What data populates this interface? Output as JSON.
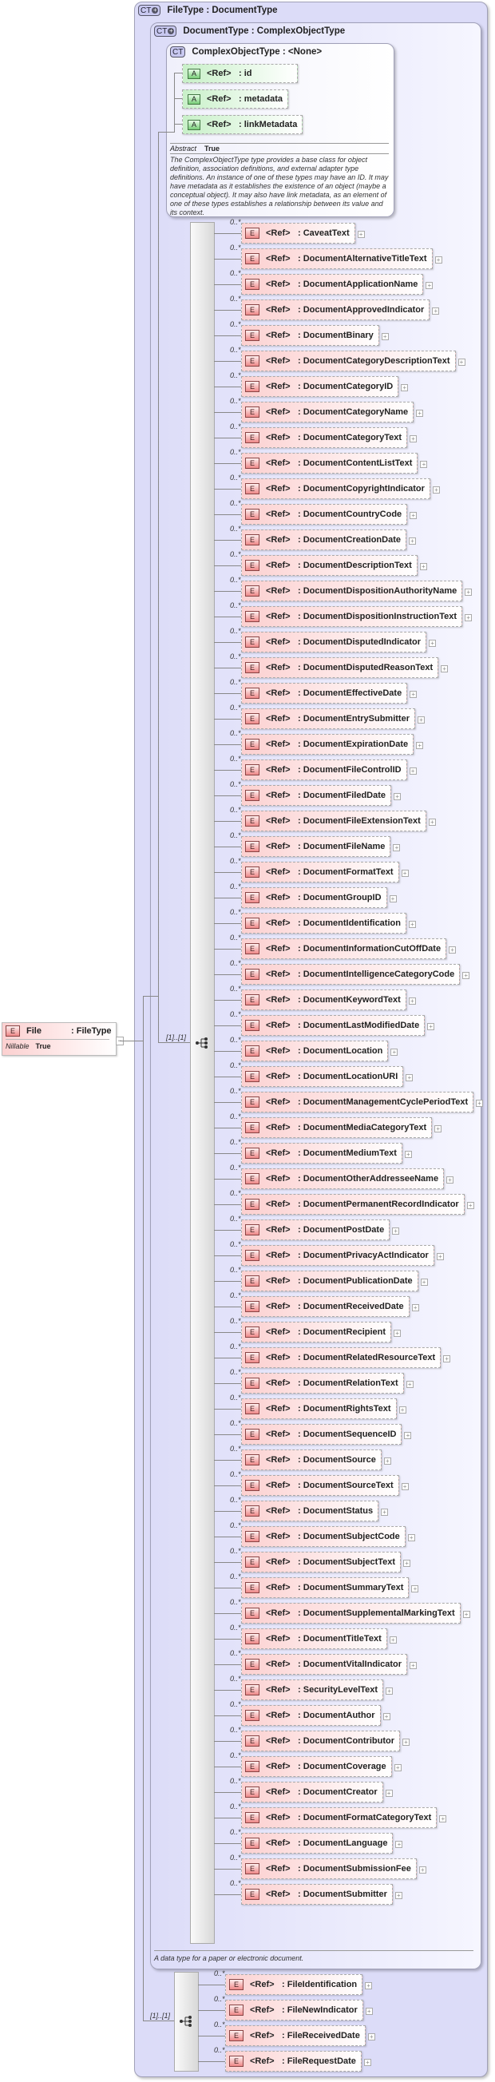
{
  "file": {
    "badge": "E",
    "name": "File",
    "type": ": FileType",
    "nillable_label": "Nillable",
    "nillable_value": "True",
    "collapse": "−"
  },
  "file_type": {
    "badge": "CT",
    "name": "FileType : DocumentType"
  },
  "document_type": {
    "badge": "CT",
    "name": "DocumentType : ComplexObjectType",
    "documentation": "A data type for a paper or electronic document."
  },
  "complex_object_type": {
    "badge": "CT",
    "name": "ComplexObjectType : <None>",
    "attributes": [
      {
        "badge": "A",
        "ref": "<Ref>",
        "name": ": id"
      },
      {
        "badge": "A",
        "ref": "<Ref>",
        "name": ": metadata"
      },
      {
        "badge": "A",
        "ref": "<Ref>",
        "name": ": linkMetadata"
      }
    ],
    "abstract_label": "Abstract",
    "abstract_value": "True",
    "documentation": "The ComplexObjectType type provides a base class for object definition, association definitions, and external adapter type definitions. An instance of one of these types may have an ID. It may have metadata as it establishes the existence of an object (maybe a conceptual object). It may also have link metadata, as an element of one of these types establishes a relationship between its value and its context."
  },
  "sequence_multiplicity": "[1]..[1]",
  "element_multiplicity": "0..*",
  "element_badge": "E",
  "ref_label": "<Ref>",
  "document_elements": [
    "CaveatText",
    "DocumentAlternativeTitleText",
    "DocumentApplicationName",
    "DocumentApprovedIndicator",
    "DocumentBinary",
    "DocumentCategoryDescriptionText",
    "DocumentCategoryID",
    "DocumentCategoryName",
    "DocumentCategoryText",
    "DocumentContentListText",
    "DocumentCopyrightIndicator",
    "DocumentCountryCode",
    "DocumentCreationDate",
    "DocumentDescriptionText",
    "DocumentDispositionAuthorityName",
    "DocumentDispositionInstructionText",
    "DocumentDisputedIndicator",
    "DocumentDisputedReasonText",
    "DocumentEffectiveDate",
    "DocumentEntrySubmitter",
    "DocumentExpirationDate",
    "DocumentFileControlID",
    "DocumentFiledDate",
    "DocumentFileExtensionText",
    "DocumentFileName",
    "DocumentFormatText",
    "DocumentGroupID",
    "DocumentIdentification",
    "DocumentInformationCutOffDate",
    "DocumentIntelligenceCategoryCode",
    "DocumentKeywordText",
    "DocumentLastModifiedDate",
    "DocumentLocation",
    "DocumentLocationURI",
    "DocumentManagementCyclePeriodText",
    "DocumentMediaCategoryText",
    "DocumentMediumText",
    "DocumentOtherAddresseeName",
    "DocumentPermanentRecordIndicator",
    "DocumentPostDate",
    "DocumentPrivacyActIndicator",
    "DocumentPublicationDate",
    "DocumentReceivedDate",
    "DocumentRecipient",
    "DocumentRelatedResourceText",
    "DocumentRelationText",
    "DocumentRightsText",
    "DocumentSequenceID",
    "DocumentSource",
    "DocumentSourceText",
    "DocumentStatus",
    "DocumentSubjectCode",
    "DocumentSubjectText",
    "DocumentSummaryText",
    "DocumentSupplementalMarkingText",
    "DocumentTitleText",
    "DocumentVitalIndicator",
    "SecurityLevelText",
    "DocumentAuthor",
    "DocumentContributor",
    "DocumentCoverage",
    "DocumentCreator",
    "DocumentFormatCategoryText",
    "DocumentLanguage",
    "DocumentSubmissionFee",
    "DocumentSubmitter"
  ],
  "file_elements": [
    "FileIdentification",
    "FileNewIndicator",
    "FileReceivedDate",
    "FileRequestDate"
  ]
}
